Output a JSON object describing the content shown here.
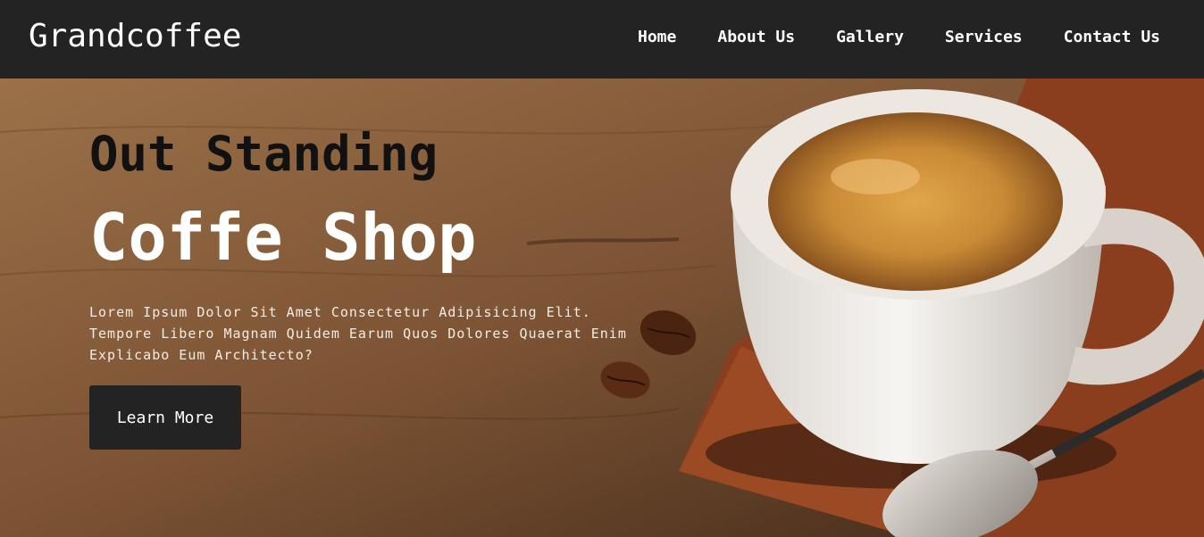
{
  "brand": {
    "logo_text": "Grandcoffee"
  },
  "nav": {
    "items": [
      {
        "label": "Home"
      },
      {
        "label": "About Us"
      },
      {
        "label": "Gallery"
      },
      {
        "label": "Services"
      },
      {
        "label": "Contact Us"
      }
    ]
  },
  "hero": {
    "headline_line1": "Out Standing",
    "headline_line2": "Coffe Shop",
    "description": "Lorem Ipsum Dolor Sit Amet Consectetur Adipisicing Elit. Tempore Libero Magnam Quidem Earum Quos Dolores Quaerat Enim Explicabo Eum Architecto?",
    "cta_label": "Learn More"
  },
  "colors": {
    "navbar_bg": "#232323",
    "button_bg": "#232323",
    "headline_dark": "#111111",
    "headline_light": "#ffffff"
  }
}
